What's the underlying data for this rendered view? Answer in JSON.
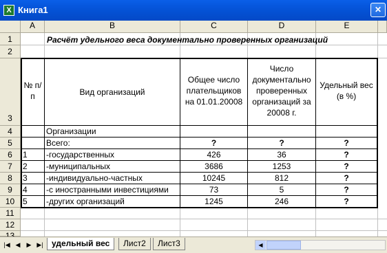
{
  "window": {
    "title": "Книга1",
    "app_icon": "excel-icon"
  },
  "columns": [
    "A",
    "B",
    "C",
    "D",
    "E"
  ],
  "rows": [
    "1",
    "2",
    "3",
    "4",
    "5",
    "6",
    "7",
    "8",
    "9",
    "10",
    "11",
    "12",
    "13"
  ],
  "sheet": {
    "title": "Расчёт удельного веса документально проверенных организаций",
    "header": {
      "a": "№ п/п",
      "b": "Вид организаций",
      "c": "Общее число плательщиков на 01.01.20008",
      "d": "Число документально проверенных организаций за 20008 г.",
      "e": "Удельный вес (в %)"
    },
    "row4": {
      "b": "Организации"
    },
    "row5": {
      "b": "Всего:",
      "c": "?",
      "d": "?",
      "e": "?"
    },
    "data": [
      {
        "a": "1",
        "b": " -государственных",
        "c": "426",
        "d": "36",
        "e": "?"
      },
      {
        "a": "2",
        "b": " -муниципальных",
        "c": "3686",
        "d": "1253",
        "e": "?"
      },
      {
        "a": "3",
        "b": " -индивидуально-частных",
        "c": "10245",
        "d": "812",
        "e": "?"
      },
      {
        "a": "4",
        "b": " -с иностранными инвестициями",
        "c": "73",
        "d": "5",
        "e": "?"
      },
      {
        "a": "5",
        "b": " -других организаций",
        "c": "1245",
        "d": "246",
        "e": "?"
      }
    ]
  },
  "tabs": [
    {
      "label": "удельный вес",
      "active": true
    },
    {
      "label": "Лист2",
      "active": false
    },
    {
      "label": "Лист3",
      "active": false
    }
  ]
}
